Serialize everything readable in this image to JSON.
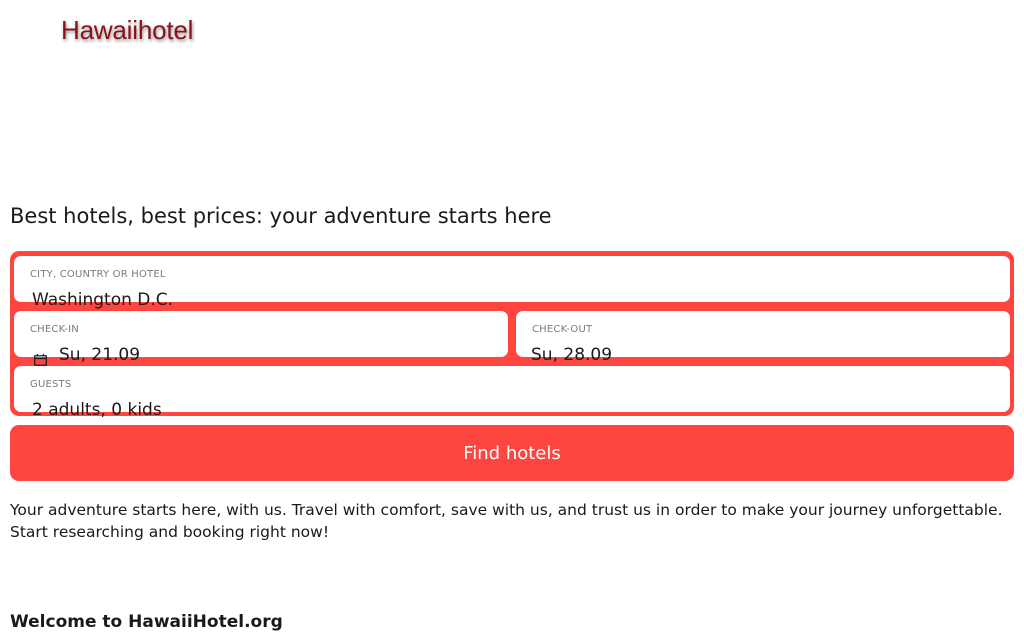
{
  "brand": {
    "logo_text": "Hawaiihotel",
    "accent_color": "#ff4540",
    "logo_color": "#8a1218"
  },
  "hero": {
    "tagline": "Best hotels, best prices: your adventure starts here"
  },
  "search": {
    "location": {
      "label": "CITY, COUNTRY OR HOTEL",
      "value": "Washington D.C."
    },
    "checkin": {
      "label": "CHECK-IN",
      "value": "Su, 21.09",
      "icon": "calendar-icon"
    },
    "checkout": {
      "label": "CHECK-OUT",
      "value": "Su, 28.09"
    },
    "guests": {
      "label": "GUESTS",
      "value": "2 adults, 0 kids"
    },
    "submit_label": "Find hotels"
  },
  "content": {
    "intro": "Your adventure starts here, with us. Travel with comfort, save with us, and trust us in order to make your journey unforgettable. Start researching and booking right now!",
    "welcome_heading": "Welcome to HawaiiHotel.org"
  }
}
